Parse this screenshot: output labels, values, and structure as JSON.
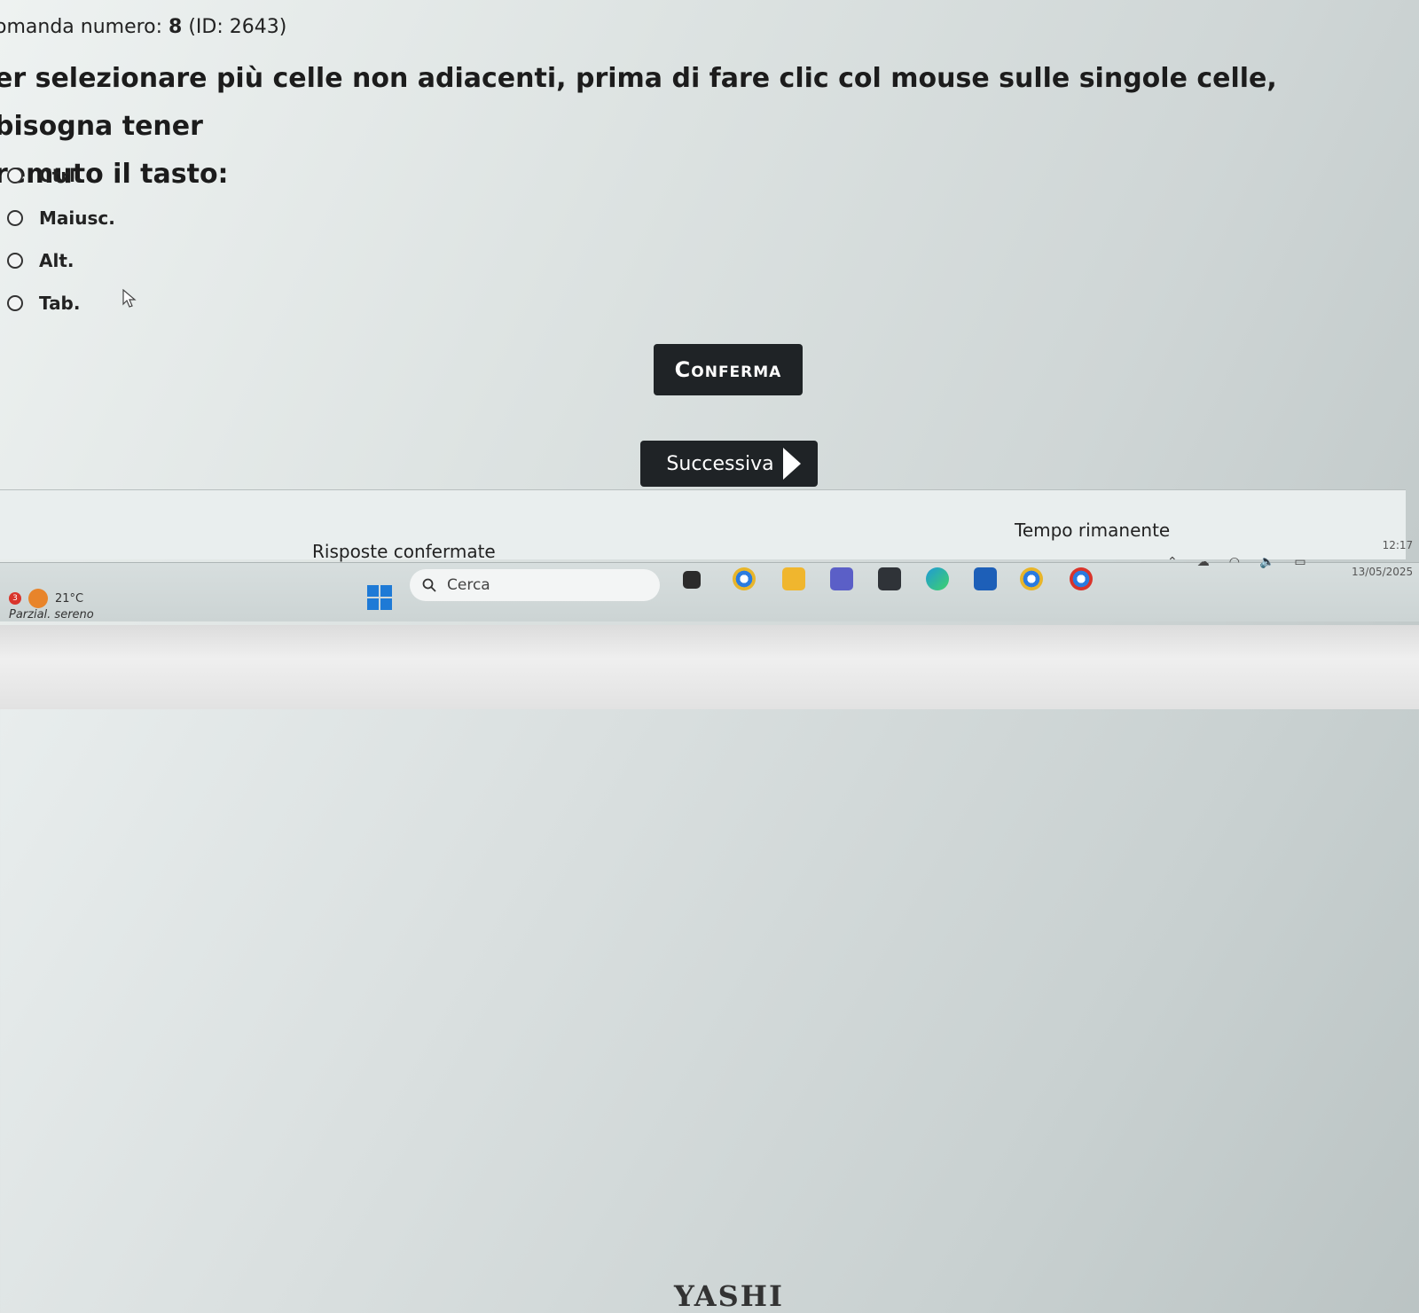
{
  "question": {
    "number_prefix": "omanda numero: ",
    "number": "8",
    "id_text": " (ID: 2643)",
    "line1": "er selezionare più celle non adiacenti, prima di fare clic col mouse sulle singole celle, bisogna tener",
    "line2": "remuto il tasto:",
    "options": [
      "Ctrl.",
      "Maiusc.",
      "Alt.",
      "Tab."
    ]
  },
  "buttons": {
    "confirm": "Conferma",
    "next": "Successiva"
  },
  "status": {
    "answers_label": "Risposte confermate",
    "time_label": "Tempo rimanente"
  },
  "taskbar": {
    "weather_temp": "21°C",
    "weather_desc": "Parzial. sereno",
    "weather_badge": "3",
    "search_placeholder": "Cerca",
    "time": "12:17",
    "date": "13/05/2025"
  },
  "bezel": {
    "brand": "YASHI"
  },
  "colors": {
    "button_bg": "#1f2326",
    "accent": "#1e7ad6"
  }
}
